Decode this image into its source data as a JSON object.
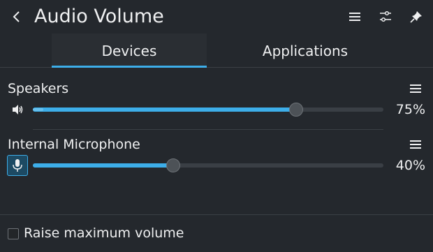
{
  "header": {
    "title": "Audio Volume",
    "icons": [
      "back-arrow-icon",
      "hamburger-menu-icon",
      "configure-icon",
      "pin-icon"
    ]
  },
  "tabs": [
    {
      "label": "Devices",
      "active": true
    },
    {
      "label": "Applications",
      "active": false
    }
  ],
  "devices": [
    {
      "name": "Speakers",
      "percent_label": "75%",
      "volume": 0.75,
      "level": 0.03,
      "icon": "speaker-icon"
    },
    {
      "name": "Internal Microphone",
      "percent_label": "40%",
      "volume": 0.4,
      "level": 0.0,
      "icon": "microphone-icon"
    }
  ],
  "footer": {
    "checkbox_label": "Raise maximum volume",
    "checked": false
  },
  "colors": {
    "accent": "#3daee9",
    "background": "#24282d",
    "text": "#eff0f1"
  }
}
